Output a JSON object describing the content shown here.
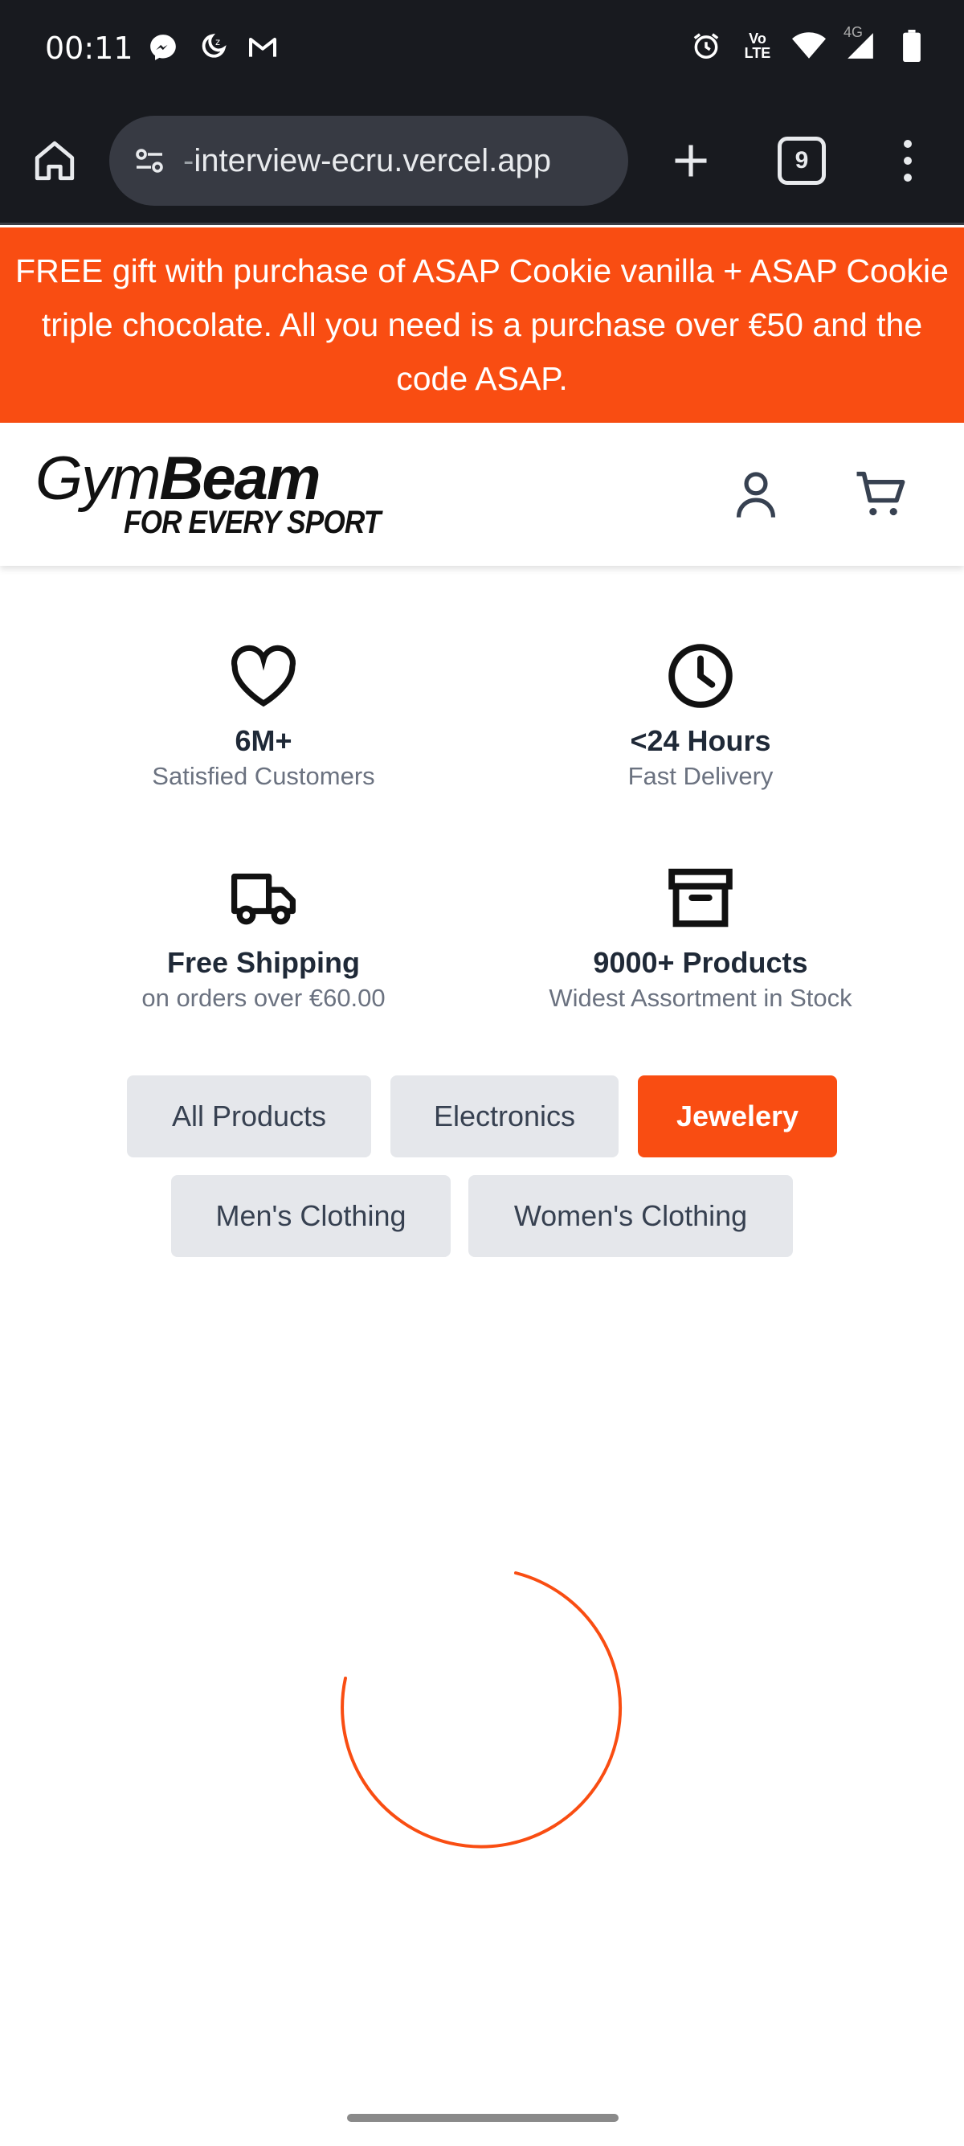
{
  "status_bar": {
    "time": "00:11",
    "network_label": "4G",
    "volte_label": "Vo LTE"
  },
  "browser": {
    "url_prefix": "-",
    "url": "interview-ecru.vercel.app",
    "tab_count": "9"
  },
  "promo": {
    "text": "FREE gift with purchase of ASAP Cookie vanilla + ASAP Cookie triple chocolate. All you need is a purchase over €50 and the code ASAP."
  },
  "header": {
    "logo_part1": "Gym",
    "logo_part2": "Beam",
    "logo_tagline": "FOR EVERY SPORT"
  },
  "features": [
    {
      "icon": "heart-icon",
      "title": "6M+",
      "subtitle": "Satisfied Customers"
    },
    {
      "icon": "clock-icon",
      "title": "<24 Hours",
      "subtitle": "Fast Delivery"
    },
    {
      "icon": "truck-icon",
      "title": "Free Shipping",
      "subtitle": "on orders over €60.00"
    },
    {
      "icon": "archive-icon",
      "title": "9000+ Products",
      "subtitle": "Widest Assortment in Stock"
    }
  ],
  "categories": {
    "selected": "Jewelery",
    "items": [
      {
        "label": "All Products"
      },
      {
        "label": "Electronics"
      },
      {
        "label": "Jewelery"
      },
      {
        "label": "Men's Clothing"
      },
      {
        "label": "Women's Clothing"
      }
    ]
  },
  "colors": {
    "accent": "#f94d12",
    "button_bg": "#e5e7eb",
    "chrome_bg": "#181a1f"
  }
}
